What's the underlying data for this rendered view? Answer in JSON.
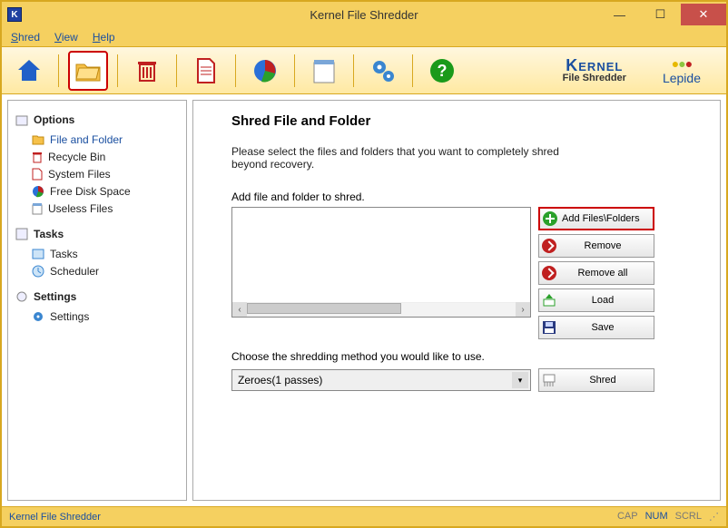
{
  "window": {
    "title": "Kernel File Shredder"
  },
  "menu": {
    "shred": "Shred",
    "view": "View",
    "help": "Help"
  },
  "brand": {
    "k1": "Kernel",
    "k2": "File Shredder",
    "lepide": "Lepide"
  },
  "sidebar": {
    "groups": [
      {
        "title": "Options",
        "items": [
          {
            "label": "File and Folder",
            "selected": true
          },
          {
            "label": "Recycle Bin"
          },
          {
            "label": "System Files"
          },
          {
            "label": "Free Disk Space"
          },
          {
            "label": "Useless Files"
          }
        ]
      },
      {
        "title": "Tasks",
        "items": [
          {
            "label": "Tasks"
          },
          {
            "label": "Scheduler"
          }
        ]
      },
      {
        "title": "Settings",
        "items": [
          {
            "label": "Settings"
          }
        ]
      }
    ]
  },
  "content": {
    "heading": "Shred File and Folder",
    "desc": "Please select the files and folders that you want to completely shred beyond recovery.",
    "addLabel": "Add file and folder to shred.",
    "chooseLabel": "Choose the shredding method you would like to use.",
    "method": "Zeroes(1 passes)",
    "buttons": {
      "add": "Add Files\\Folders",
      "remove": "Remove",
      "removeAll": "Remove all",
      "load": "Load",
      "save": "Save",
      "shred": "Shred"
    }
  },
  "status": {
    "text": "Kernel File Shredder",
    "cap": "CAP",
    "num": "NUM",
    "scrl": "SCRL"
  }
}
